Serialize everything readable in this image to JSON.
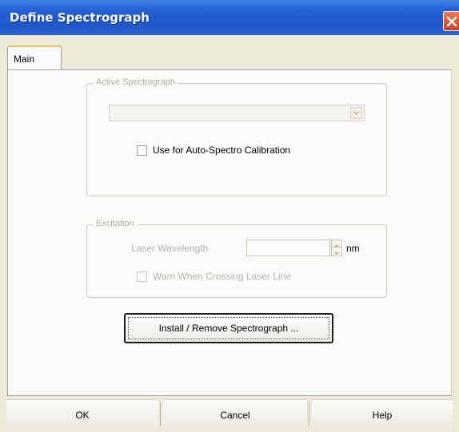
{
  "window": {
    "title": "Define Spectrograph"
  },
  "tabs": [
    {
      "label": "Main",
      "selected": true
    }
  ],
  "active_spectrograph": {
    "group_label": "Active Spectrograph",
    "selected_value": "",
    "auto_calibration_label": "Use for Auto-Spectro Calibration",
    "auto_calibration_checked": false
  },
  "excitation": {
    "group_label": "Excitation",
    "laser_wavelength_label": "Laser Wavelength",
    "laser_wavelength_value": "",
    "unit": "nm",
    "warn_label": "Warn When Crossing Laser Line",
    "warn_checked": false
  },
  "install_button_label": "Install / Remove Spectrograph ...",
  "footer": {
    "ok_label": "OK",
    "cancel_label": "Cancel",
    "help_label": "Help"
  },
  "colors": {
    "titlebar": "#2563d6",
    "dialog_bg": "#ece9d8",
    "tab_accent": "#f2c160",
    "close_button": "#c9402a"
  },
  "icons": {
    "close": "close-x-icon",
    "combo": "chevron-down-icon",
    "spin_up": "spin-up-arrow-icon",
    "spin_down": "spin-down-arrow-icon"
  }
}
